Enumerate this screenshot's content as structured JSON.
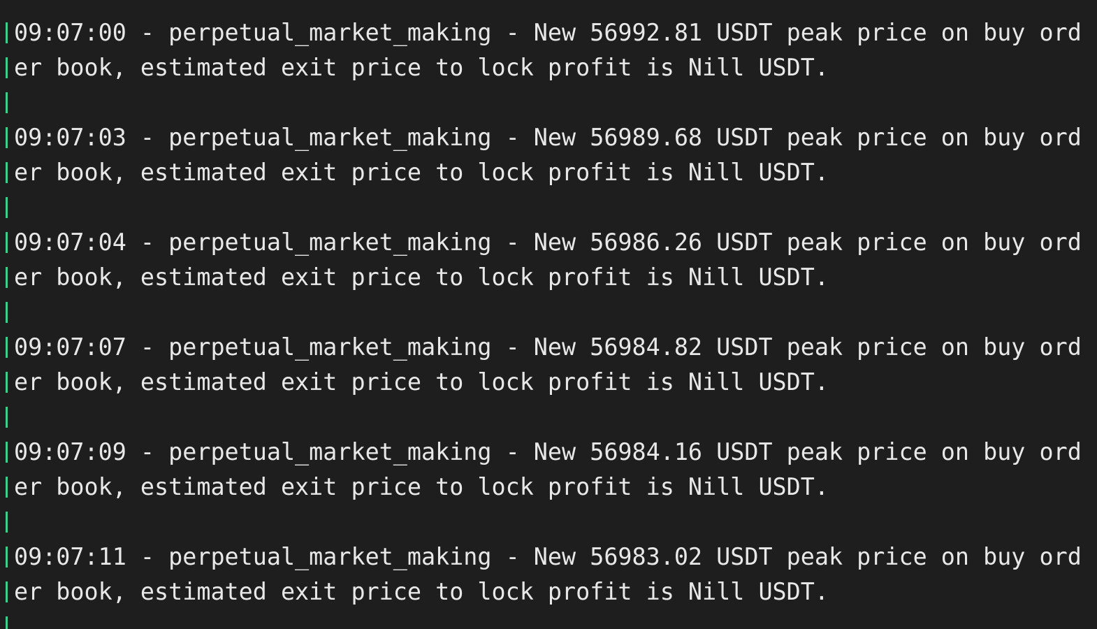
{
  "colors": {
    "background": "#1e1e1e",
    "text": "#e8e8e8",
    "gutter": "#3ecf8e"
  },
  "log": {
    "entries": [
      {
        "line1": "09:07:00 - perpetual_market_making - New 56992.81 USDT peak price on buy ord",
        "line2": "er book, estimated exit price to lock profit is Nill USDT."
      },
      {
        "line1": "09:07:03 - perpetual_market_making - New 56989.68 USDT peak price on buy ord",
        "line2": "er book, estimated exit price to lock profit is Nill USDT."
      },
      {
        "line1": "09:07:04 - perpetual_market_making - New 56986.26 USDT peak price on buy ord",
        "line2": "er book, estimated exit price to lock profit is Nill USDT."
      },
      {
        "line1": "09:07:07 - perpetual_market_making - New 56984.82 USDT peak price on buy ord",
        "line2": "er book, estimated exit price to lock profit is Nill USDT."
      },
      {
        "line1": "09:07:09 - perpetual_market_making - New 56984.16 USDT peak price on buy ord",
        "line2": "er book, estimated exit price to lock profit is Nill USDT."
      },
      {
        "line1": "09:07:11 - perpetual_market_making - New 56983.02 USDT peak price on buy ord",
        "line2": "er book, estimated exit price to lock profit is Nill USDT."
      }
    ]
  }
}
